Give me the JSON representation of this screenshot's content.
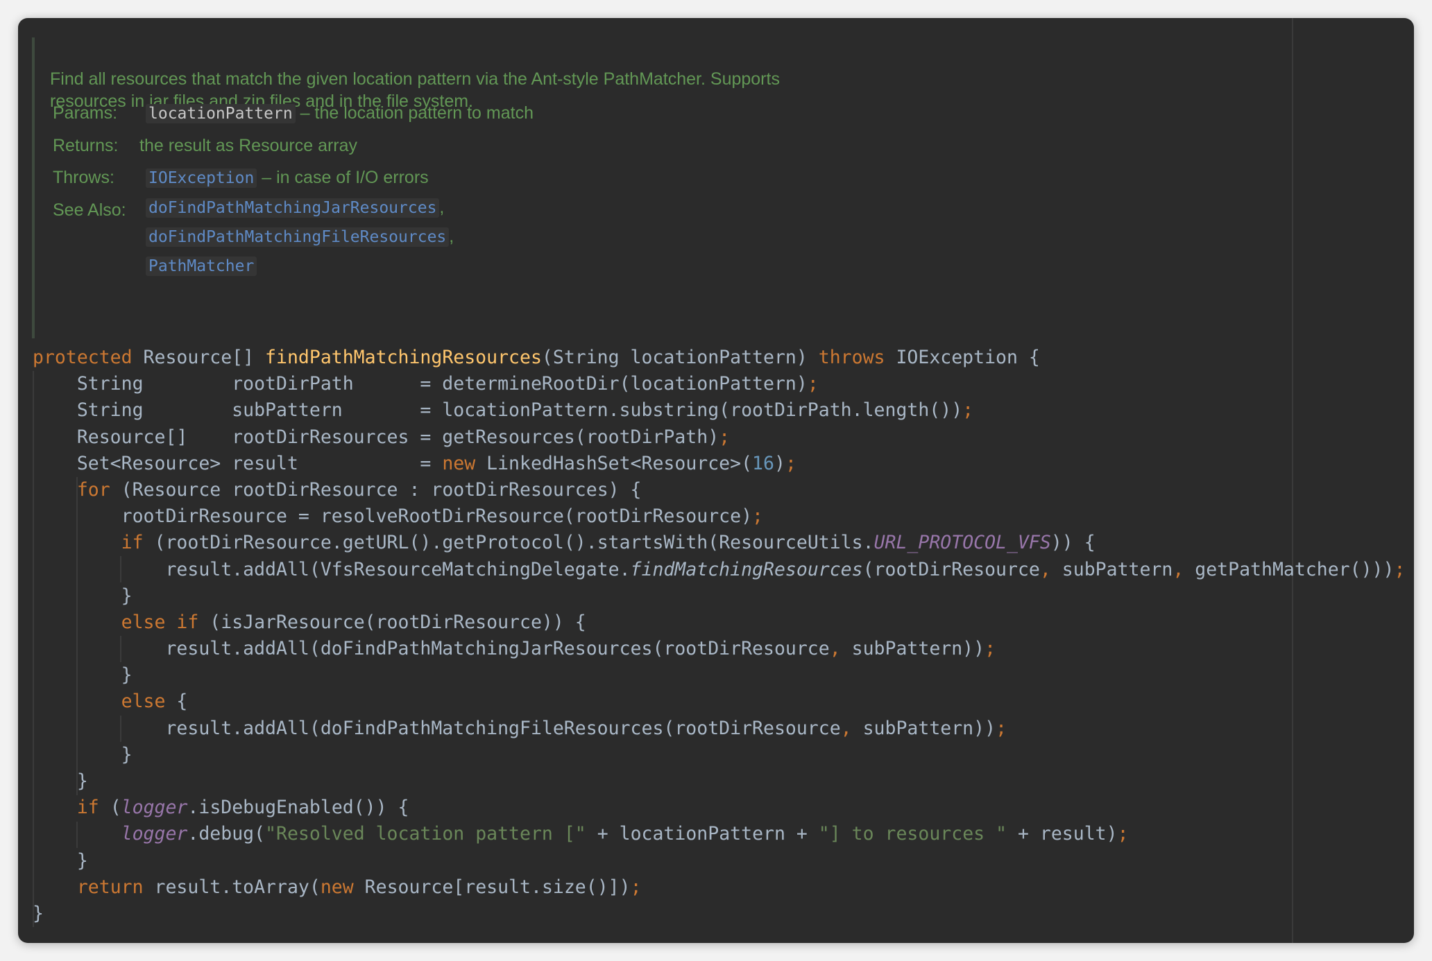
{
  "javadoc": {
    "description_lines": [
      "Find all resources that match the given location pattern via the Ant-style PathMatcher. Supports",
      "resources in jar files and zip files and in the file system."
    ],
    "params": {
      "label": "Params:",
      "name": "locationPattern",
      "desc": "– the location pattern to match"
    },
    "returns": {
      "label": "Returns:",
      "desc": "the result as Resource array"
    },
    "throws": {
      "label": "Throws:",
      "name": "IOException",
      "desc": "– in case of I/O errors"
    },
    "see_also": {
      "label": "See Also:",
      "links": [
        "doFindPathMatchingJarResources",
        "doFindPathMatchingFileResources",
        "PathMatcher"
      ],
      "separators": [
        ",",
        ",",
        ""
      ]
    }
  },
  "code_lines": [
    [
      [
        "kw",
        "protected"
      ],
      [
        "p",
        " Resource[] "
      ],
      [
        "fn",
        "findPathMatchingResources"
      ],
      [
        "p",
        "(String locationPattern) "
      ],
      [
        "kw",
        "throws"
      ],
      [
        "p",
        " IOException {"
      ]
    ],
    [
      [
        "p",
        "    String        rootDirPath      = determineRootDir(locationPattern)"
      ],
      [
        "pu",
        ";"
      ]
    ],
    [
      [
        "p",
        "    String        subPattern       = locationPattern.substring(rootDirPath.length())"
      ],
      [
        "pu",
        ";"
      ]
    ],
    [
      [
        "p",
        "    Resource[]    rootDirResources = getResources(rootDirPath)"
      ],
      [
        "pu",
        ";"
      ]
    ],
    [
      [
        "p",
        "    Set<Resource> result           = "
      ],
      [
        "kw",
        "new"
      ],
      [
        "p",
        " LinkedHashSet<Resource>("
      ],
      [
        "num",
        "16"
      ],
      [
        "p",
        ")"
      ],
      [
        "pu",
        ";"
      ]
    ],
    [
      [
        "p",
        "    "
      ],
      [
        "kw",
        "for"
      ],
      [
        "p",
        " (Resource rootDirResource : rootDirResources) {"
      ]
    ],
    [
      [
        "p",
        "        rootDirResource = resolveRootDirResource(rootDirResource)"
      ],
      [
        "pu",
        ";"
      ]
    ],
    [
      [
        "p",
        "        "
      ],
      [
        "kw",
        "if"
      ],
      [
        "p",
        " (rootDirResource.getURL().getProtocol().startsWith(ResourceUtils."
      ],
      [
        "st",
        "URL_PROTOCOL_VFS"
      ],
      [
        "p",
        ")) {"
      ]
    ],
    [
      [
        "p",
        "            result.addAll(VfsResourceMatchingDelegate."
      ],
      [
        "it",
        "findMatchingResources"
      ],
      [
        "p",
        "(rootDirResource"
      ],
      [
        "pu",
        ","
      ],
      [
        "p",
        " subPattern"
      ],
      [
        "pu",
        ","
      ],
      [
        "p",
        " getPathMatcher()))"
      ],
      [
        "pu",
        ";"
      ]
    ],
    [
      [
        "p",
        "        }"
      ]
    ],
    [
      [
        "p",
        "        "
      ],
      [
        "kw",
        "else if"
      ],
      [
        "p",
        " (isJarResource(rootDirResource)) {"
      ]
    ],
    [
      [
        "p",
        "            result.addAll(doFindPathMatchingJarResources(rootDirResource"
      ],
      [
        "pu",
        ","
      ],
      [
        "p",
        " subPattern))"
      ],
      [
        "pu",
        ";"
      ]
    ],
    [
      [
        "p",
        "        }"
      ]
    ],
    [
      [
        "p",
        "        "
      ],
      [
        "kw",
        "else"
      ],
      [
        "p",
        " {"
      ]
    ],
    [
      [
        "p",
        "            result.addAll(doFindPathMatchingFileResources(rootDirResource"
      ],
      [
        "pu",
        ","
      ],
      [
        "p",
        " subPattern))"
      ],
      [
        "pu",
        ";"
      ]
    ],
    [
      [
        "p",
        "        }"
      ]
    ],
    [
      [
        "p",
        "    }"
      ]
    ],
    [
      [
        "p",
        "    "
      ],
      [
        "kw",
        "if"
      ],
      [
        "p",
        " ("
      ],
      [
        "st",
        "logger"
      ],
      [
        "p",
        ".isDebugEnabled()) {"
      ]
    ],
    [
      [
        "p",
        "        "
      ],
      [
        "st",
        "logger"
      ],
      [
        "p",
        ".debug("
      ],
      [
        "str",
        "\"Resolved location pattern [\""
      ],
      [
        "p",
        " + locationPattern + "
      ],
      [
        "str",
        "\"] to resources \""
      ],
      [
        "p",
        " + result)"
      ],
      [
        "pu",
        ";"
      ]
    ],
    [
      [
        "p",
        "    }"
      ]
    ],
    [
      [
        "p",
        "    "
      ],
      [
        "kw",
        "return"
      ],
      [
        "p",
        " result.toArray("
      ],
      [
        "kw",
        "new"
      ],
      [
        "p",
        " Resource[result.size()])"
      ],
      [
        "pu",
        ";"
      ]
    ],
    [
      [
        "p",
        "}"
      ]
    ]
  ],
  "colors": {
    "background": "#2b2b2b",
    "keyword": "#cc7832",
    "function": "#ffc66d",
    "number": "#6897bb",
    "string": "#6a8759",
    "static_field": "#9876aa",
    "javadoc_text": "#629755",
    "javadoc_link": "#5f8bc7"
  }
}
